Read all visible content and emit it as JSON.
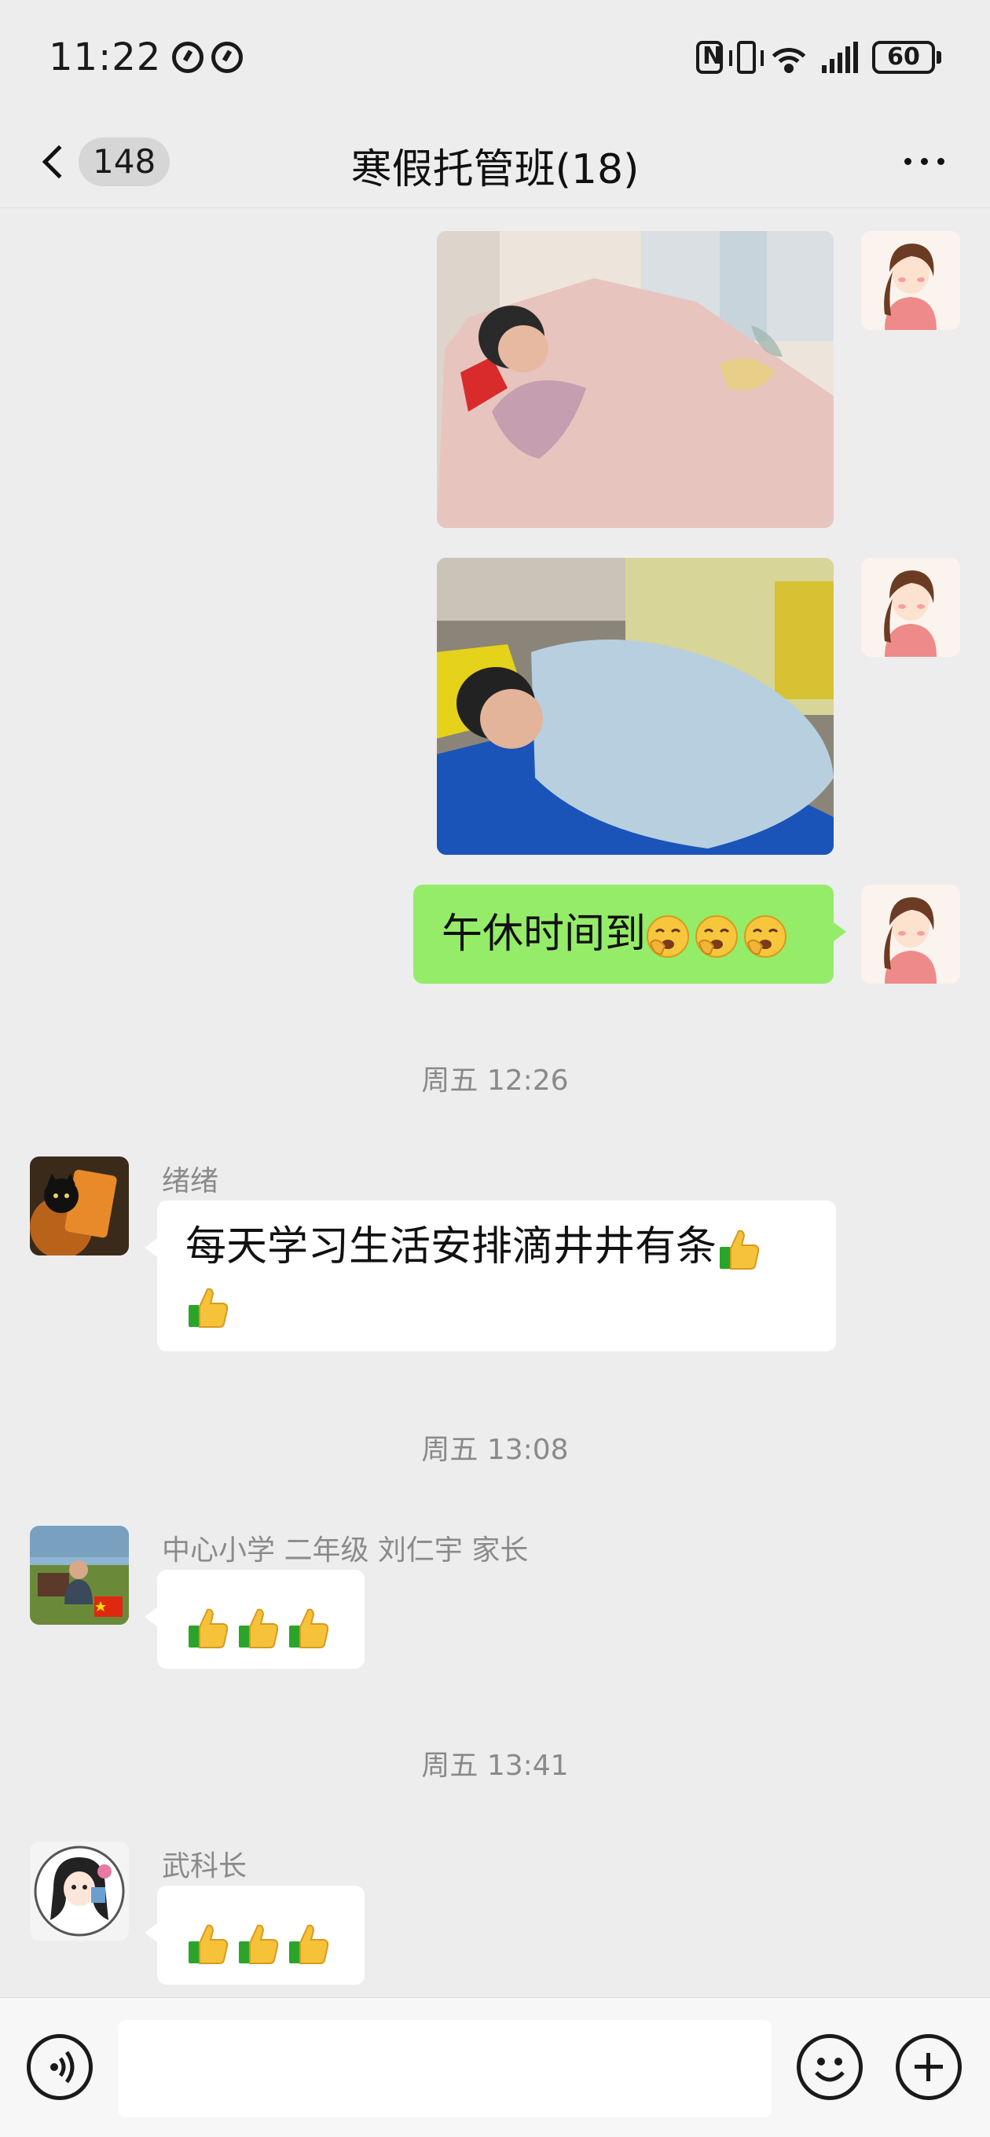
{
  "status_bar": {
    "time": "11:22",
    "battery": "60"
  },
  "header": {
    "back_count": "148",
    "title": "寒假托管班(18)"
  },
  "messages": {
    "my_text": "午休时间到",
    "time1": "周五 12:26",
    "m1": {
      "sender": "绪绪",
      "text": "每天学习生活安排滴井井有条"
    },
    "time2": "周五 13:08",
    "m2": {
      "sender": "中心小学 二年级 刘仁宇 家长"
    },
    "time3": "周五 13:41",
    "m3": {
      "sender": "武科长"
    }
  },
  "icons": {
    "yawn": "yawning-face-emoji",
    "thumb": "thumbs-up-emoji",
    "voice": "voice-icon",
    "emoji": "emoji-icon",
    "plus": "plus-icon",
    "more": "more-icon",
    "back": "chevron-left-icon"
  },
  "colors": {
    "my_bubble": "#95ec69",
    "other_bubble": "#ffffff",
    "background": "#ededed"
  },
  "input": {
    "value": ""
  }
}
